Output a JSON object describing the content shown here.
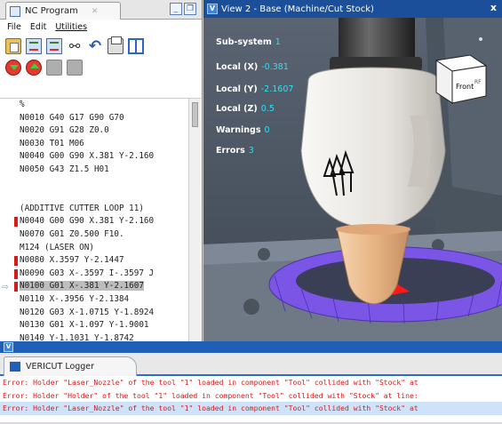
{
  "nc_program": {
    "tab_title": "NC Program",
    "menu": [
      "File",
      "Edit",
      "Utilities"
    ],
    "toolbar_row1": [
      "open-clipboard-icon",
      "grid-report-icon",
      "table-edit-icon",
      "binoculars-icon",
      "undo-icon",
      "print-icon",
      "split-view-icon"
    ],
    "toolbar_row2": [
      "run-down-icon",
      "step-up-icon",
      "disabled-tool-icon",
      "disabled-stop-icon"
    ],
    "lines": [
      {
        "text": "%",
        "marker": false,
        "current": false
      },
      {
        "text": "N0010 G40 G17 G90 G70",
        "marker": false,
        "current": false
      },
      {
        "text": "N0020 G91 G28 Z0.0",
        "marker": false,
        "current": false
      },
      {
        "text": "N0030 T01 M06",
        "marker": false,
        "current": false
      },
      {
        "text": "N0040 G00 G90 X.381 Y-2.160",
        "marker": false,
        "current": false
      },
      {
        "text": "N0050 G43 Z1.5 H01",
        "marker": false,
        "current": false
      },
      {
        "text": "",
        "marker": false,
        "current": false
      },
      {
        "text": "",
        "marker": false,
        "current": false
      },
      {
        "text": "(ADDITIVE CUTTER LOOP 11)",
        "marker": false,
        "current": false
      },
      {
        "text": "N0040 G00 G90 X.381 Y-2.160",
        "marker": true,
        "current": false
      },
      {
        "text": "N0070 G01 Z0.500 F10.",
        "marker": false,
        "current": false
      },
      {
        "text": "M124 (LASER ON)",
        "marker": false,
        "current": false
      },
      {
        "text": "N0080 X.3597 Y-2.1447",
        "marker": true,
        "current": false
      },
      {
        "text": "N0090 G03 X-.3597 I-.3597 J",
        "marker": true,
        "current": false
      },
      {
        "text": "N0100 G01 X-.381 Y-2.1607",
        "marker": true,
        "current": true
      },
      {
        "text": "N0110 X-.3956 Y-2.1384",
        "marker": false,
        "current": false
      },
      {
        "text": "N0120 G03 X-1.0715 Y-1.8924",
        "marker": false,
        "current": false
      },
      {
        "text": "N0130 G01 X-1.097 Y-1.9001",
        "marker": false,
        "current": false
      },
      {
        "text": "N0140 Y-1.1031 Y-1.8742",
        "marker": false,
        "current": false
      }
    ]
  },
  "view": {
    "title": "View 2 - Base (Machine/Cut Stock)",
    "close": "x",
    "cube_label": "Front",
    "cube_side": "RF",
    "info": [
      {
        "label": "Sub-system",
        "value": "1"
      },
      {
        "label": "Local (X)",
        "value": "-0.381"
      },
      {
        "label": "Local (Y)",
        "value": "-2.1607"
      },
      {
        "label": "Local (Z)",
        "value": "0.5"
      },
      {
        "label": "Warnings",
        "value": "0"
      },
      {
        "label": "Errors",
        "value": "3"
      }
    ],
    "colors": {
      "stock": "#7a55e6",
      "collision": "#ff1a1a",
      "nozzle": "#f0c9a0",
      "head": "#eceae6",
      "background": "#505a68"
    }
  },
  "logger": {
    "tab_title": "VERICUT Logger",
    "lines": [
      {
        "text": "Error: Holder \"Laser_Nozzle\" of the tool \"1\" loaded in component \"Tool\" collided with \"Stock\" at",
        "selected": false
      },
      {
        "text": "Error: Holder \"Holder\" of the tool \"1\" loaded in component \"Tool\" collided with \"Stock\" at line:",
        "selected": false
      },
      {
        "text": "Error: Holder \"Laser_Nozzle\" of the tool \"1\" loaded in component \"Tool\" collided with \"Stock\" at",
        "selected": true
      }
    ]
  }
}
